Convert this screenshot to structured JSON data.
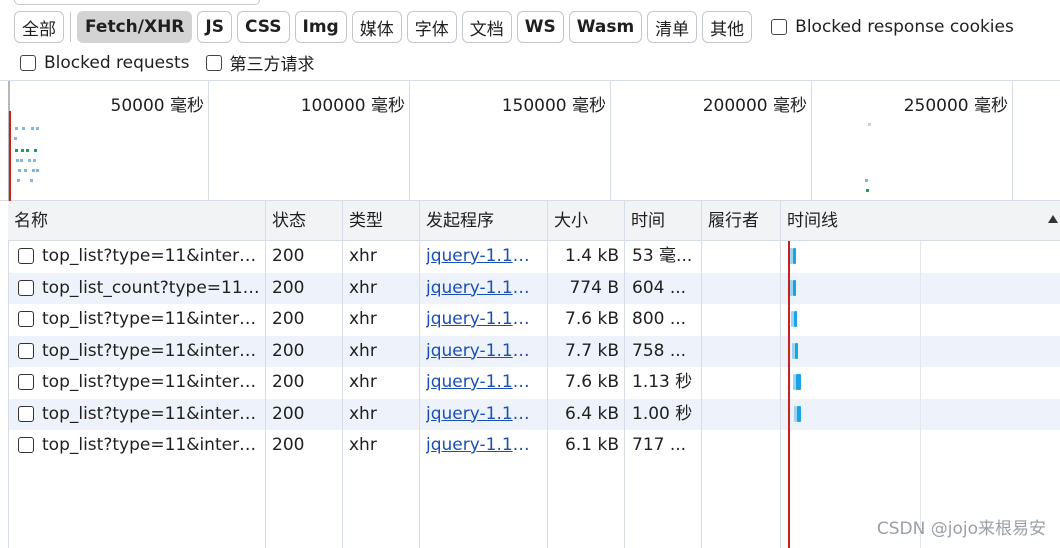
{
  "filters": {
    "types": [
      {
        "label": "全部",
        "active": false
      },
      {
        "label": "Fetch/XHR",
        "active": true
      },
      {
        "label": "JS",
        "active": false
      },
      {
        "label": "CSS",
        "active": false
      },
      {
        "label": "Img",
        "active": false
      },
      {
        "label": "媒体",
        "active": false
      },
      {
        "label": "字体",
        "active": false
      },
      {
        "label": "文档",
        "active": false
      },
      {
        "label": "WS",
        "active": false
      },
      {
        "label": "Wasm",
        "active": false
      },
      {
        "label": "清单",
        "active": false
      },
      {
        "label": "其他",
        "active": false
      }
    ],
    "blocked_cookies": "Blocked response cookies",
    "blocked_requests": "Blocked requests",
    "third_party": "第三方请求"
  },
  "overview": {
    "ticks": [
      "50000  毫秒",
      "100000  毫秒",
      "150000  毫秒",
      "200000  毫秒",
      "250000  毫秒"
    ]
  },
  "table": {
    "columns": [
      "名称",
      "状态",
      "类型",
      "发起程序",
      "大小",
      "时间",
      "履行者",
      "时间线"
    ],
    "rows": [
      {
        "name": "top_list?type=11&interva...",
        "status": "200",
        "type": "xhr",
        "initiator": "jquery-1.10....",
        "size": "1.4 kB",
        "time": "53  毫...",
        "bar_start": 0.3,
        "bar_end": 0.85
      },
      {
        "name": "top_list_count?type=11&i...",
        "status": "200",
        "type": "xhr",
        "initiator": "jquery-1.10....",
        "size": "774 B",
        "time": "604  ...",
        "bar_start": 0.3,
        "bar_end": 0.85
      },
      {
        "name": "top_list?type=11&interva...",
        "status": "200",
        "type": "xhr",
        "initiator": "jquery-1.10....",
        "size": "7.6 kB",
        "time": "800  ...",
        "bar_start": 0.35,
        "bar_end": 1.0
      },
      {
        "name": "top_list?type=11&interva...",
        "status": "200",
        "type": "xhr",
        "initiator": "jquery-1.10....",
        "size": "7.7 kB",
        "time": "758  ...",
        "bar_start": 0.6,
        "bar_end": 1.4
      },
      {
        "name": "top_list?type=11&interva...",
        "status": "200",
        "type": "xhr",
        "initiator": "jquery-1.10....",
        "size": "7.6 kB",
        "time": "1.13 秒",
        "bar_start": 0.8,
        "bar_end": 1.95
      },
      {
        "name": "top_list?type=11&interva...",
        "status": "200",
        "type": "xhr",
        "initiator": "jquery-1.10....",
        "size": "6.4 kB",
        "time": "1.00 秒",
        "bar_start": 1.05,
        "bar_end": 2.05
      },
      {
        "name": "top_list?type=11&interva...",
        "status": "200",
        "type": "xhr",
        "initiator": "jquery-1.10....",
        "size": "6.1 kB",
        "time": "717  ...",
        "bar_start": 0.0,
        "bar_end": 0.0
      }
    ]
  },
  "colors": {
    "bar": "#1aa3e8",
    "bar_light": "#9fd4ef",
    "marker": "#c5221f"
  },
  "watermark": "CSDN @jojo来根易安"
}
